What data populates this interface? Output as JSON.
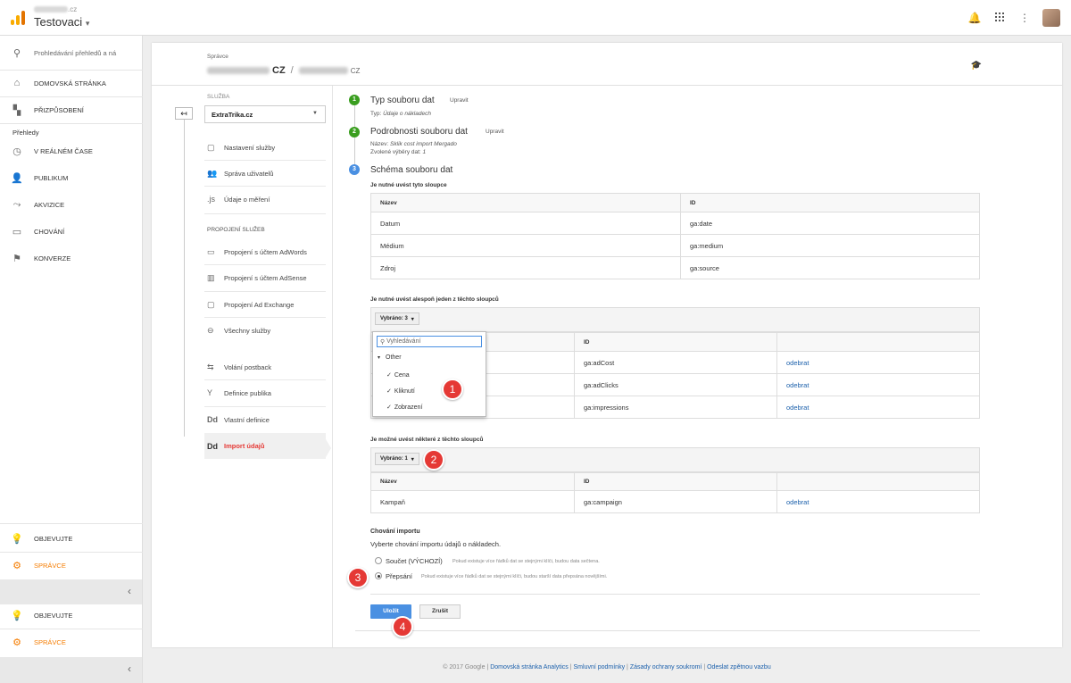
{
  "header": {
    "account_suffix": ".cz",
    "account_name": "Testovaci",
    "account_caret": "▾",
    "icons": [
      "bell-icon",
      "apps-grid-icon",
      "more-vert-icon",
      "avatar"
    ]
  },
  "leftnav": {
    "search_placeholder": "Prohledávání přehledů a ná",
    "items": [
      {
        "label": "DOMOVSKÁ STRÁNKA",
        "icon": "home-icon"
      },
      {
        "label": "PŘIZPŮSOBENÍ",
        "icon": "customize-icon"
      }
    ],
    "reports_heading": "Přehledy",
    "reports": [
      {
        "label": "V REÁLNÉM ČASE",
        "icon": "clock-icon"
      },
      {
        "label": "PUBLIKUM",
        "icon": "person-icon"
      },
      {
        "label": "AKVIZICE",
        "icon": "acquisition-icon"
      },
      {
        "label": "CHOVÁNÍ",
        "icon": "behavior-icon"
      },
      {
        "label": "KONVERZE",
        "icon": "flag-icon"
      }
    ],
    "discover_label": "OBJEVUJTE",
    "admin_label": "SPRÁVCE",
    "collapse_glyph": "‹"
  },
  "breadcrumb": {
    "small": "Správce",
    "account_tld": "CZ",
    "separator": "/",
    "property_tld": "CZ"
  },
  "service_nav": {
    "label": "SLUŽBA",
    "back_glyph": "↤",
    "selected_property": "ExtraTrika.cz",
    "items": [
      {
        "label": "Nastavení služby",
        "icon": "settings-window-icon",
        "glyph": "▢"
      },
      {
        "label": "Správa uživatelů",
        "icon": "users-icon",
        "glyph": "👥"
      },
      {
        "label": "Údaje o měření",
        "icon": "js-icon",
        "glyph": ".js"
      }
    ],
    "links_heading": "PROPOJENÍ SLUŽEB",
    "links": [
      {
        "label": "Propojení s účtem AdWords",
        "icon": "adwords-icon",
        "glyph": "▭"
      },
      {
        "label": "Propojení s účtem AdSense",
        "icon": "adsense-icon",
        "glyph": "▥"
      },
      {
        "label": "Propojení Ad Exchange",
        "icon": "adexchange-icon",
        "glyph": "▢"
      },
      {
        "label": "Všechny služby",
        "icon": "all-services-icon",
        "glyph": "⊖"
      }
    ],
    "extra": [
      {
        "label": "Volání postback",
        "icon": "postback-icon",
        "glyph": "⇆"
      },
      {
        "label": "Definice publika",
        "icon": "audience-icon",
        "glyph": "Y"
      },
      {
        "label": "Vlastní definice",
        "icon": "dd-icon",
        "glyph": "Dd"
      },
      {
        "label": "Import údajů",
        "icon": "dd-icon",
        "glyph": "Dd"
      }
    ]
  },
  "steps": {
    "step1": {
      "num": "1",
      "title": "Typ souboru dat",
      "edit": "Upravit",
      "detail_label": "Typ:",
      "detail_value": "Údaje o nákladech"
    },
    "step2": {
      "num": "2",
      "title": "Podrobnosti souboru dat",
      "edit": "Upravit",
      "name_label": "Název:",
      "name_value": "Sklik cost import Mergado",
      "views_label": "Zvolené výběry dat:",
      "views_value": "1"
    },
    "step3": {
      "num": "3",
      "title": "Schéma souboru dat"
    }
  },
  "required": {
    "title": "Je nutné uvést tyto sloupce",
    "headers": [
      "Název",
      "ID"
    ],
    "rows": [
      [
        "Datum",
        "ga:date"
      ],
      [
        "Médium",
        "ga:medium"
      ],
      [
        "Zdroj",
        "ga:source"
      ]
    ]
  },
  "at_least_one": {
    "title": "Je nutné uvést alespoň jeden z těchto sloupců",
    "dropdown": "Vybráno: 3",
    "header_id": "ID",
    "rows": [
      {
        "id": "ga:adCost",
        "action": "odebrat"
      },
      {
        "id": "ga:adClicks",
        "action": "odebrat"
      },
      {
        "id": "ga:impressions",
        "action": "odebrat"
      }
    ],
    "popup": {
      "search_placeholder": "Vyhledávání",
      "group": "Other",
      "options": [
        "Cena",
        "Kliknutí",
        "Zobrazení"
      ]
    }
  },
  "optional": {
    "title": "Je možné uvést některé z těchto sloupců",
    "dropdown": "Vybráno: 1",
    "headers": [
      "Název",
      "ID"
    ],
    "rows": [
      {
        "name": "Kampaň",
        "id": "ga:campaign",
        "action": "odebrat"
      }
    ]
  },
  "import_behavior": {
    "title": "Chování importu",
    "subtitle": "Vyberte chování importu údajů o nákladech.",
    "options": [
      {
        "label": "Součet (VÝCHOZÍ)",
        "hint": "Pokud existuje více řádků dat se stejnými klíči, budou data sečtena.",
        "checked": false
      },
      {
        "label": "Přepsání",
        "hint": "Pokud existuje více řádků dat se stejnými klíči, budou starší data přepsána novějšími.",
        "checked": true
      }
    ]
  },
  "actions": {
    "save": "Uložit",
    "cancel": "Zrušit"
  },
  "badges": [
    "1",
    "2",
    "3",
    "4"
  ],
  "footer": {
    "copyright": "© 2017 Google",
    "sep": "|",
    "links": [
      "Domovská stránka Analytics",
      "Smluvní podmínky",
      "Zásady ochrany soukromí",
      "Odeslat zpětnou vazbu"
    ]
  },
  "colors": {
    "accent_blue": "#4a90e2",
    "step_green": "#3a9e1f",
    "badge_red": "#e53935",
    "admin_orange": "#f57c00",
    "link": "#1a5fab"
  }
}
